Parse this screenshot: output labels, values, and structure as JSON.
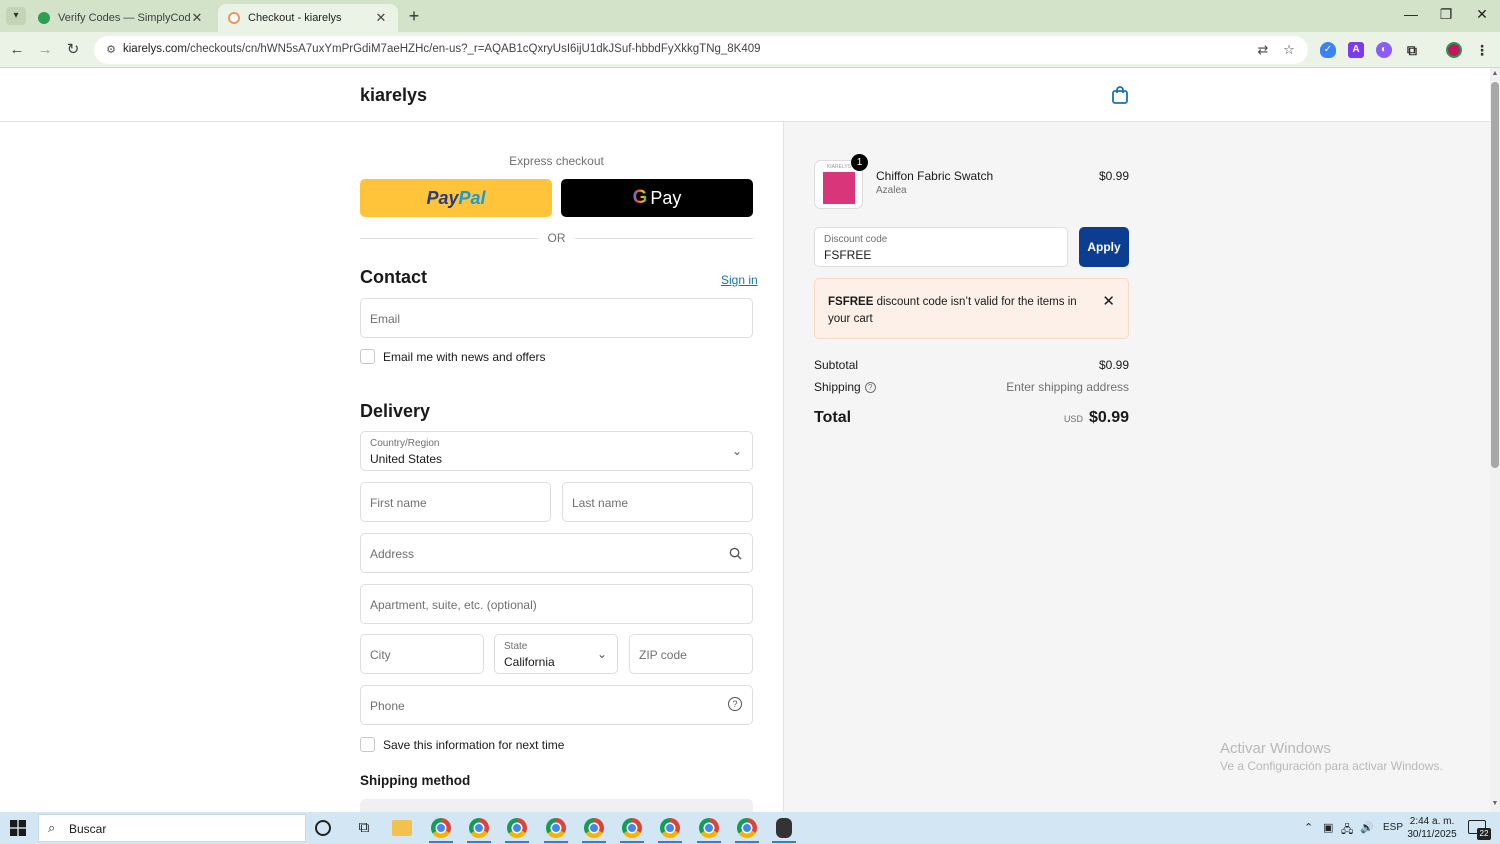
{
  "browser": {
    "tabs": [
      {
        "title": "Verify Codes — SimplyCodes",
        "active": false
      },
      {
        "title": "Checkout - kiarelys",
        "active": true
      }
    ],
    "url_host": "kiarelys.com",
    "url_path": "/checkouts/cn/hWN5sA7uxYmPrGdiM7aeHZHc/en-us?_r=AQAB1cQxryUsI6ijU1dkJSuf-hbbdFyXkkgTNg_8K409",
    "colors": {
      "tabstrip": "#d3e3c9",
      "toolbar": "#ebf3e6"
    }
  },
  "store": {
    "brand": "kiarelys"
  },
  "express": {
    "label": "Express checkout",
    "paypal_a": "Pay",
    "paypal_b": "Pal",
    "gpay_g": "G",
    "gpay_text": "Pay",
    "or_label": "OR"
  },
  "contact": {
    "heading": "Contact",
    "sign_in": "Sign in",
    "email_placeholder": "Email",
    "news_label": "Email me with news and offers"
  },
  "delivery": {
    "heading": "Delivery",
    "country_label": "Country/Region",
    "country_value": "United States",
    "first_name_placeholder": "First name",
    "last_name_placeholder": "Last name",
    "address_placeholder": "Address",
    "apartment_placeholder": "Apartment, suite, etc. (optional)",
    "city_placeholder": "City",
    "state_label": "State",
    "state_value": "California",
    "zip_placeholder": "ZIP code",
    "phone_placeholder": "Phone",
    "save_label": "Save this information for next time",
    "shipping_method_heading": "Shipping method"
  },
  "summary": {
    "item": {
      "quantity": "1",
      "name": "Chiffon Fabric Swatch",
      "variant": "Azalea",
      "price": "$0.99",
      "swatch_tag": "KIARELYS",
      "swatch_color": "#d9357a"
    },
    "discount_label": "Discount code",
    "discount_value": "FSFREE",
    "apply_label": "Apply",
    "alert_code": "FSFREE",
    "alert_text": " discount code isn’t valid for the items in your cart",
    "subtotal_label": "Subtotal",
    "subtotal_value": "$0.99",
    "shipping_label": "Shipping",
    "shipping_value": "Enter shipping address",
    "total_label": "Total",
    "total_currency": "USD",
    "total_value": "$0.99",
    "accent_color": "#0b3e92"
  },
  "watermark": {
    "line1": "Activar Windows",
    "line2": "Ve a Configuración para activar Windows."
  },
  "taskbar": {
    "search_placeholder": "Buscar",
    "language": "ESP",
    "time": "2:44 a. m.",
    "date": "30/11/2025",
    "notifications": "22"
  }
}
